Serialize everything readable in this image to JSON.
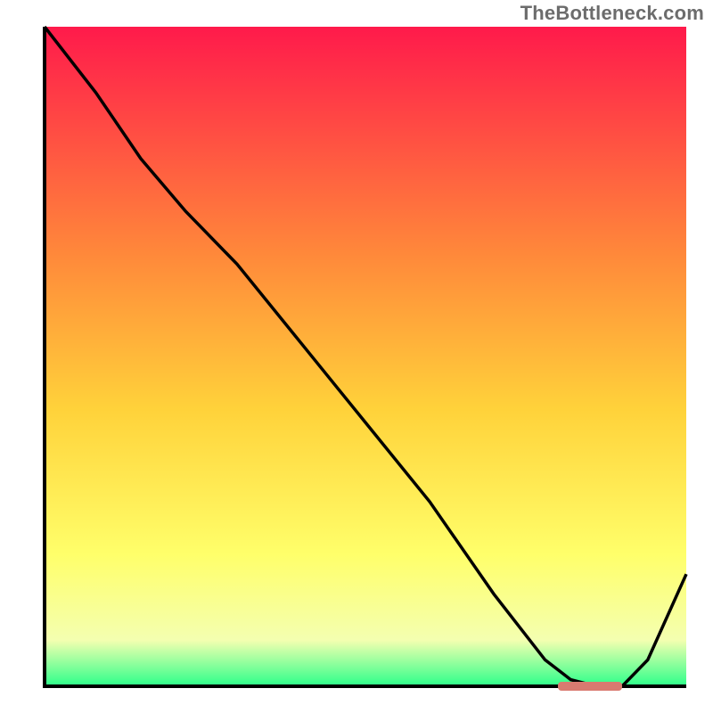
{
  "attribution": "TheBottleneck.com",
  "colors": {
    "grad_top": "#ff1a4b",
    "grad_mid1": "#ff8a3a",
    "grad_mid2": "#ffd23a",
    "grad_mid3": "#ffff6a",
    "grad_mid4": "#f4ffb0",
    "grad_bottom": "#2cff8a",
    "axis": "#000000",
    "curve": "#000000",
    "marker": "#d97a70"
  },
  "chart_data": {
    "type": "line",
    "title": "",
    "xlabel": "",
    "ylabel": "",
    "xlim": [
      0,
      100
    ],
    "ylim": [
      0,
      100
    ],
    "x": [
      0,
      8,
      15,
      22,
      30,
      40,
      50,
      60,
      70,
      78,
      82,
      86,
      90,
      94,
      100
    ],
    "values": [
      100,
      90,
      80,
      72,
      64,
      52,
      40,
      28,
      14,
      4,
      1,
      0,
      0,
      4,
      17
    ],
    "marker_range_x": [
      80,
      90
    ],
    "marker_y": 0
  }
}
